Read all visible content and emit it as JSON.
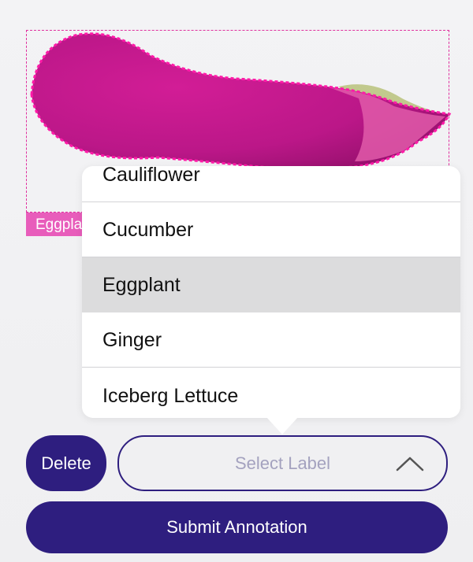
{
  "annotation": {
    "label_tag": "Eggplant",
    "colors": {
      "outline": "#e0309e",
      "fill": "#c71b8f",
      "tag_bg": "#e85dbb"
    }
  },
  "dropdown": {
    "options": [
      "Cauliflower",
      "Cucumber",
      "Eggplant",
      "Ginger",
      "Iceberg Lettuce"
    ],
    "selected_option": "Eggplant"
  },
  "controls": {
    "delete_label": "Delete",
    "select_placeholder": "Select Label",
    "submit_label": "Submit Annotation",
    "chevron_icon": "chevron-up-icon",
    "accent": "#2e1e7f"
  }
}
